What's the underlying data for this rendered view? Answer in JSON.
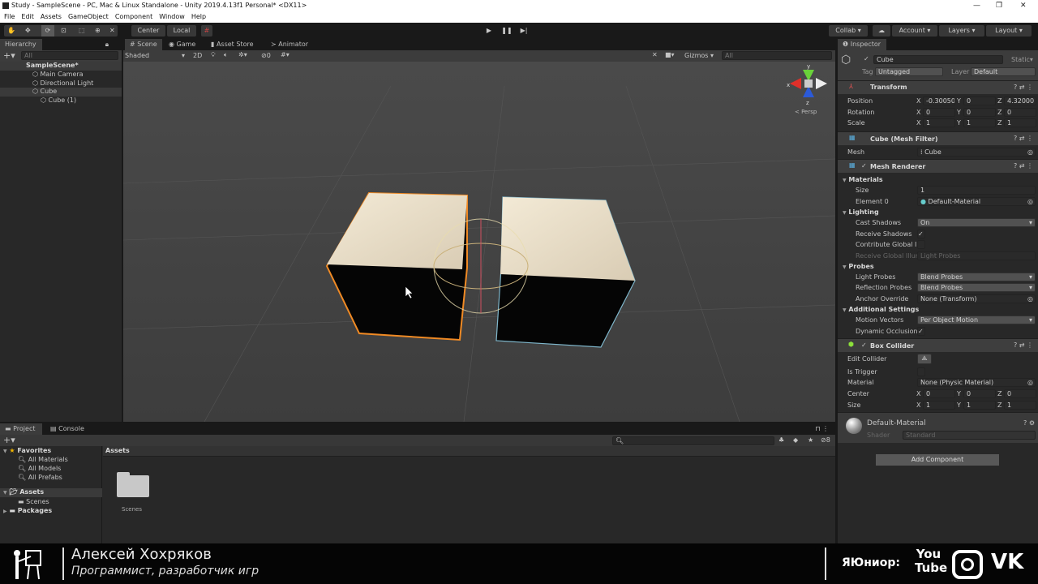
{
  "window": {
    "title": "Study - SampleScene - PC, Mac & Linux Standalone - Unity 2019.4.13f1 Personal* <DX11>"
  },
  "menu": [
    "File",
    "Edit",
    "Assets",
    "GameObject",
    "Component",
    "Window",
    "Help"
  ],
  "toolbar": {
    "center": "Center",
    "local": "Local",
    "collab": "Collab",
    "account": "Account",
    "layers": "Layers",
    "layout": "Layout"
  },
  "hierarchy": {
    "title": "Hierarchy",
    "search_placeholder": "All",
    "scene": "SampleScene*",
    "items": [
      "Main Camera",
      "Directional Light",
      "Cube",
      "Cube (1)"
    ]
  },
  "scene": {
    "tabs": [
      "Scene",
      "Game",
      "Asset Store",
      "Animator"
    ],
    "shading": "Shaded",
    "mode_2d": "2D",
    "hidden_count": "0",
    "gizmos": "Gizmos",
    "search_placeholder": "All",
    "persp": "< Persp",
    "axes": {
      "x": "x",
      "y": "y",
      "z": "z"
    }
  },
  "inspector": {
    "title": "Inspector",
    "name": "Cube",
    "static": "Static",
    "tag_label": "Tag",
    "tag": "Untagged",
    "layer_label": "Layer",
    "layer": "Default",
    "transform": {
      "title": "Transform",
      "position_label": "Position",
      "rotation_label": "Rotation",
      "scale_label": "Scale",
      "position": [
        "-0.30050",
        "0",
        "4.32000"
      ],
      "rotation": [
        "0",
        "0",
        "0"
      ],
      "scale": [
        "1",
        "1",
        "1"
      ]
    },
    "mesh_filter": {
      "title": "Cube (Mesh Filter)",
      "mesh_label": "Mesh",
      "mesh": "Cube"
    },
    "mesh_renderer": {
      "title": "Mesh Renderer",
      "materials": "Materials",
      "size_label": "Size",
      "size": "1",
      "element_label": "Element 0",
      "element": "Default-Material",
      "lighting": "Lighting",
      "cast_shadows_label": "Cast Shadows",
      "cast_shadows": "On",
      "receive_shadows_label": "Receive Shadows",
      "contribute_gi_label": "Contribute Global Ill",
      "receive_gi_label": "Receive Global Illum",
      "receive_gi": "Light Probes",
      "probes": "Probes",
      "light_probes_label": "Light Probes",
      "light_probes": "Blend Probes",
      "reflection_probes_label": "Reflection Probes",
      "reflection_probes": "Blend Probes",
      "anchor_label": "Anchor Override",
      "anchor": "None (Transform)",
      "additional": "Additional Settings",
      "motion_vectors_label": "Motion Vectors",
      "motion_vectors": "Per Object Motion",
      "dynamic_occlusion_label": "Dynamic Occlusion"
    },
    "box_collider": {
      "title": "Box Collider",
      "edit_label": "Edit Collider",
      "trigger_label": "Is Trigger",
      "material_label": "Material",
      "material": "None (Physic Material)",
      "center_label": "Center",
      "center": [
        "0",
        "0",
        "0"
      ],
      "size_label": "Size",
      "size": [
        "1",
        "1",
        "1"
      ]
    },
    "material": {
      "name": "Default-Material",
      "shader_label": "Shader",
      "shader": "Standard"
    },
    "add_component": "Add Component"
  },
  "project": {
    "tabs": [
      "Project",
      "Console"
    ],
    "favorites": "Favorites",
    "fav_items": [
      "All Materials",
      "All Models",
      "All Prefabs"
    ],
    "assets": "Assets",
    "scenes": "Scenes",
    "packages": "Packages",
    "breadcrumb": "Assets",
    "folder": "Scenes",
    "hidden_count": "8"
  },
  "banner": {
    "name": "Алексей Хохряков",
    "role": "Программист, разработчик игр",
    "brand": "ЯЮниор:",
    "youtube": "You Tube"
  },
  "colors": {
    "selection_outline": "#f08a24",
    "accent": "#3a72b0"
  }
}
